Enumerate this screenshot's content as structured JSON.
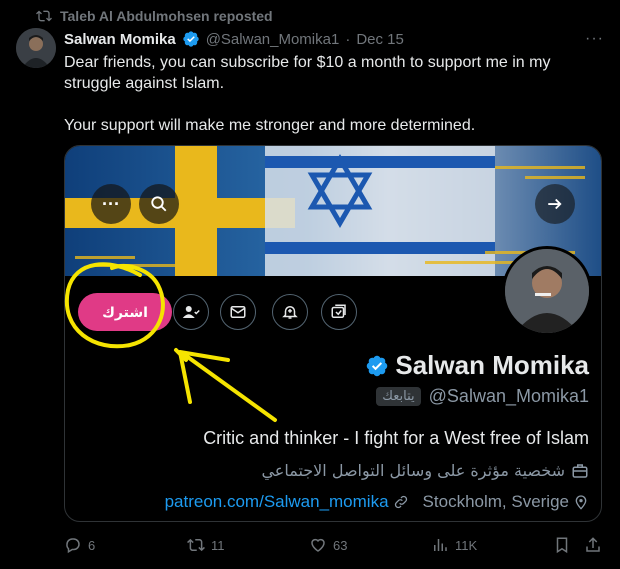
{
  "repost": {
    "text": "Taleb Al Abdulmohsen reposted",
    "icon": "repost-icon"
  },
  "tweet": {
    "author_name": "Salwan Momika",
    "author_handle": "@Salwan_Momika1",
    "separator": "·",
    "date": "Dec 15",
    "more": "···",
    "text_line1": "Dear friends, you can subscribe for $10 a month to support me in my struggle against Islam.",
    "text_line2": "Your support will make me stronger and more determined."
  },
  "profile_card": {
    "subscribe_label": "اشترك",
    "display_name": "Salwan Momika",
    "follows_you_badge": "يتابعك",
    "handle": "@Salwan_Momika1",
    "bio": "Critic and thinker - I fight for a West free of Islam",
    "category": "شخصية مؤثرة على وسائل التواصل الاجتماعي",
    "link": "patreon.com/Salwan_momika",
    "location": "Stockholm, Sverige",
    "icons": [
      "more-icon",
      "search-icon",
      "arrow-right-icon",
      "follow-icon",
      "mail-icon",
      "notification-icon",
      "retweet-card-icon",
      "verified-icon",
      "briefcase-icon",
      "link-icon",
      "location-icon"
    ]
  },
  "actions": {
    "replies": "6",
    "reposts": "11",
    "likes": "63",
    "views": "11K"
  },
  "colors": {
    "accent": "#1d9bf0",
    "subscribe": "#e03a86",
    "annotation": "#f5e400",
    "muted": "#71767b"
  }
}
